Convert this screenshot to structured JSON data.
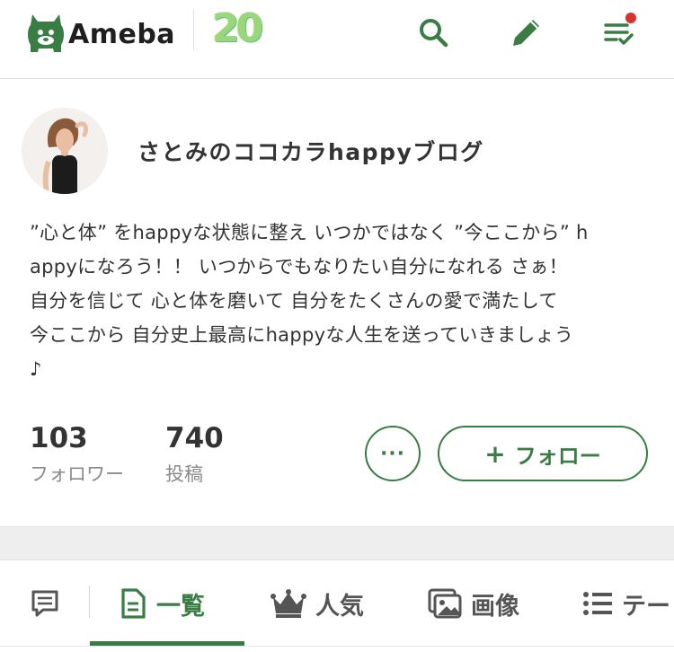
{
  "header": {
    "logo_text": "Ameba",
    "badge_text": "20",
    "colors": {
      "brand_green": "#3a7d44",
      "notify_red": "#d9322d",
      "badge_green": "#9ad67c"
    },
    "icons": [
      "ameba-mascot-icon",
      "search-icon",
      "pencil-icon",
      "feed-icon"
    ]
  },
  "profile": {
    "blog_title": "さとみのココカラhappyブログ",
    "bio_lines": [
      "”心と体” をhappyな状態に整え いつかではなく ”今ここから” h",
      "appyになろう！！ いつからでもなりたい自分になれる さぁ！",
      "自分を信じて 心と体を磨いて 自分をたくさんの愛で満たして",
      "今ここから 自分史上最高にhappyな人生を送っていきましょう",
      "♪"
    ]
  },
  "stats": {
    "followers_count": "103",
    "followers_label": "フォロワー",
    "posts_count": "740",
    "posts_label": "投稿"
  },
  "actions": {
    "more_label": "···",
    "follow_plus": "+",
    "follow_label": "フォロー"
  },
  "tabs": {
    "items": [
      {
        "label": "",
        "icon": "message-icon"
      },
      {
        "label": "一覧",
        "icon": "document-icon",
        "active": true
      },
      {
        "label": "人気",
        "icon": "crown-icon"
      },
      {
        "label": "画像",
        "icon": "images-icon"
      },
      {
        "label": "テー",
        "icon": "list-icon"
      }
    ]
  }
}
